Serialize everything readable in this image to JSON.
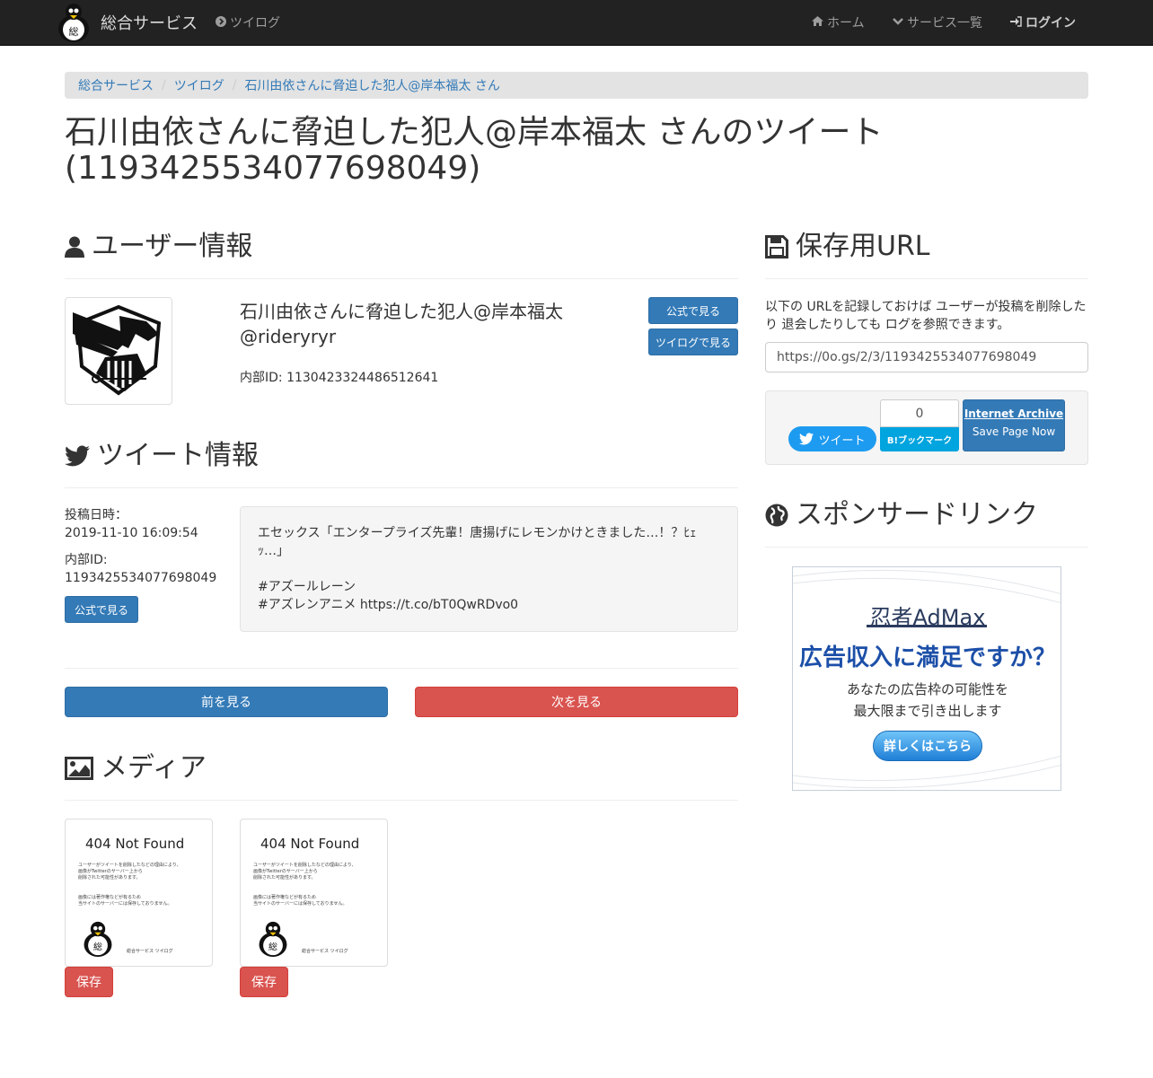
{
  "navbar": {
    "brand": "総合サービス",
    "twilog": "ツイログ",
    "home": "ホーム",
    "services": "サービス一覧",
    "login": "ログイン"
  },
  "breadcrumb": [
    "総合サービス",
    "ツイログ",
    "石川由依さんに脅迫した犯人@岸本福太 さん"
  ],
  "page_title": "石川由依さんに脅迫した犯人@岸本福太 さんのツイート (1193425534077698049)",
  "user_section": {
    "heading": "ユーザー情報",
    "display_name": "石川由依さんに脅迫した犯人@岸本福太",
    "screen_name": "@rideryryr",
    "internal_id": "内部ID: 1130423324486512641",
    "official_button": "公式で見る",
    "twilog_button": "ツイログで見る"
  },
  "tweet_section": {
    "heading": "ツイート情報",
    "posted_label": "投稿日時：",
    "posted_value": "2019-11-10 16:09:54",
    "id_label": "内部ID:",
    "id_value": "1193425534077698049",
    "official_button": "公式で見る",
    "text": "エセックス「エンタープライズ先輩！唐揚げにレモンかけときました…！？ﾋｪｯ…」\n\n#アズールレーン\n#アズレンアニメ https://t.co/bT0QwRDvo0"
  },
  "pager": {
    "prev": "前を見る",
    "next": "次を見る"
  },
  "media_section": {
    "heading": "メディア",
    "items": [
      {
        "not_found": "404 Not Found",
        "line1": "ユーザーがツイートを削除したなどの理由により、",
        "line2": "画像がTwitterのサーバー上から",
        "line3": "削除された可能性があります。",
        "line4": "画像には著作権などが有るため",
        "line5": "当サイトのサーバーには保存しておりません。",
        "credit": "総合サービス ツイログ",
        "save_button": "保存"
      },
      {
        "not_found": "404 Not Found",
        "line1": "ユーザーがツイートを削除したなどの理由により、",
        "line2": "画像がTwitterのサーバー上から",
        "line3": "削除された可能性があります。",
        "line4": "画像には著作権などが有るため",
        "line5": "当サイトのサーバーには保存しておりません。",
        "credit": "総合サービス ツイログ",
        "save_button": "保存"
      }
    ]
  },
  "save_url_section": {
    "heading": "保存用URL",
    "description": "以下の URLを記録しておけば ユーザーが投稿を削除したり 退会したりしても ログを参照できます。",
    "url": "https://0o.gs/2/3/1193425534077698049",
    "tweet_button": "ツイート",
    "hatena_count": "0",
    "hatena_button": "B!ブックマーク",
    "archive_title": "Internet Archive",
    "archive_sub": "Save Page Now"
  },
  "sponsor_section": {
    "heading": "スポンサードリンク",
    "ad_logo": "忍者AdMax",
    "ad_headline": "広告収入に満足ですか？",
    "ad_sub1": "あなたの広告枠の可能性を",
    "ad_sub2": "最大限まで引き出します",
    "ad_cta": "詳しくはこちら"
  },
  "colors": {
    "primary": "#337ab7",
    "danger": "#d9534f",
    "navbar": "#222222",
    "twitter": "#1d9bf0",
    "hatena": "#00a4de"
  }
}
